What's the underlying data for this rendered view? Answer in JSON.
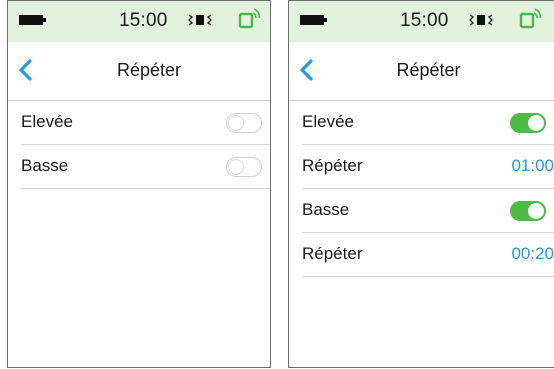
{
  "colors": {
    "status_bar_bg": "#e3f2dc",
    "accent_blue": "#1f9be8",
    "toggle_on": "#4dbb45",
    "signal_green": "#47b84a"
  },
  "left_screen": {
    "status_bar": {
      "time": "15:00",
      "icons": [
        "battery-icon",
        "vibrate-icon",
        "phone-signal-icon"
      ]
    },
    "nav": {
      "back_icon": "chevron-left-icon",
      "title": "Répéter"
    },
    "rows": [
      {
        "label": "Elevée",
        "toggle": "off"
      },
      {
        "label": "Basse",
        "toggle": "off"
      }
    ]
  },
  "right_screen": {
    "status_bar": {
      "time": "15:00",
      "icons": [
        "battery-icon",
        "vibrate-icon",
        "phone-signal-icon"
      ]
    },
    "nav": {
      "back_icon": "chevron-left-icon",
      "title": "Répéter"
    },
    "rows": [
      {
        "label": "Elevée",
        "toggle": "on"
      },
      {
        "label": "Répéter",
        "value": "01:00"
      },
      {
        "label": "Basse",
        "toggle": "on"
      },
      {
        "label": "Répéter",
        "value": "00:20"
      }
    ]
  }
}
